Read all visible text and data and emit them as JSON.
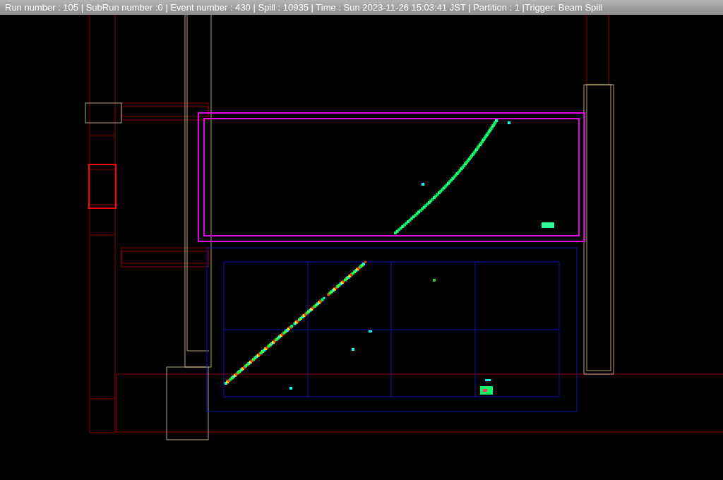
{
  "header": {
    "text": "Run number : 105 | SubRun number :0 | Event number : 430 | Spill : 10935 | Time : Sun 2023-11-26 15:03:41 JST | Partition : 1 |Trigger: Beam Spill"
  }
}
